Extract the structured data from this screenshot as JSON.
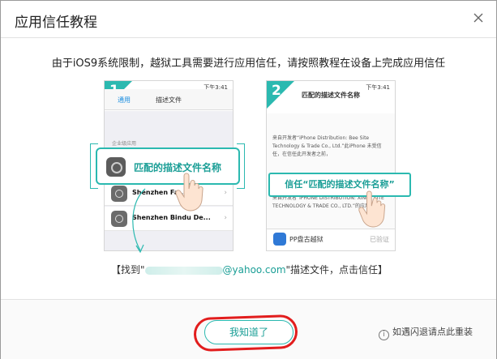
{
  "dialog": {
    "title": "应用信任教程",
    "instruction": "由于iOS9系统限制，越狱工具需要进行应用信任，请按照教程在设备上完成应用信任"
  },
  "step1": {
    "number": "1",
    "time": "下午3:41",
    "back": "通用",
    "nav_title": "描述文件",
    "section": "企业级应用",
    "callout": "匹配的描述文件名称",
    "rows": [
      "Shenzhen Fa...",
      "Shenzhen Bindu De..."
    ],
    "chevron": "›"
  },
  "step2": {
    "number": "2",
    "time": "下午3:41",
    "nav_title": "匹配的描述文件名称",
    "desc1": "来自开发者“iPhone Distribution: Bee Site Technology & Trade Co., Ltd.”此iPhone 未受信任，在信任此开发者之前，",
    "desc2": "来自开发者“iPHONE DISTRIBUTION: XINKE SITE TECHNOLOGY & TRADE CO., LTD.”的应用",
    "callout": "信任“匹配的描述文件名称”",
    "app_name": "PP盘古越狱",
    "app_status": "已验证"
  },
  "find": {
    "prefix": "【找到\"",
    "email": "@yahoo.com",
    "suffix": "\"描述文件，点击信任】"
  },
  "footer": {
    "ok": "我知道了",
    "reinstall": "如遇闪退请点此重装",
    "info_icon": "i"
  },
  "colors": {
    "accent": "#2bb9b0",
    "highlight": "#e21d1d"
  }
}
